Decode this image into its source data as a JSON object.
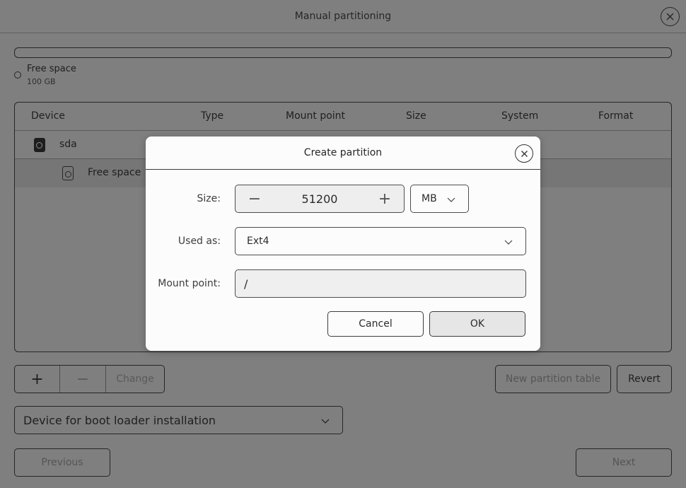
{
  "window": {
    "title": "Manual partitioning"
  },
  "disk_usage": {
    "legend_name": "Free space",
    "legend_size": "100 GB"
  },
  "table": {
    "columns": [
      "Device",
      "Type",
      "Mount point",
      "Size",
      "System",
      "Format"
    ],
    "rows": [
      {
        "device": "sda"
      },
      {
        "device": "Free space"
      }
    ]
  },
  "toolbar": {
    "add_label": "+",
    "remove_label": "−",
    "change_label": "Change",
    "new_table_label": "New partition table",
    "revert_label": "Revert"
  },
  "boot": {
    "label": "Device for boot loader installation"
  },
  "nav": {
    "previous_label": "Previous",
    "next_label": "Next"
  },
  "dialog": {
    "title": "Create partition",
    "size_label": "Size:",
    "size_value": "51200",
    "decrement": "−",
    "increment": "+",
    "unit": "MB",
    "used_as_label": "Used as:",
    "used_as_value": "Ext4",
    "mount_label": "Mount point:",
    "mount_value": "/",
    "cancel_label": "Cancel",
    "ok_label": "OK"
  }
}
